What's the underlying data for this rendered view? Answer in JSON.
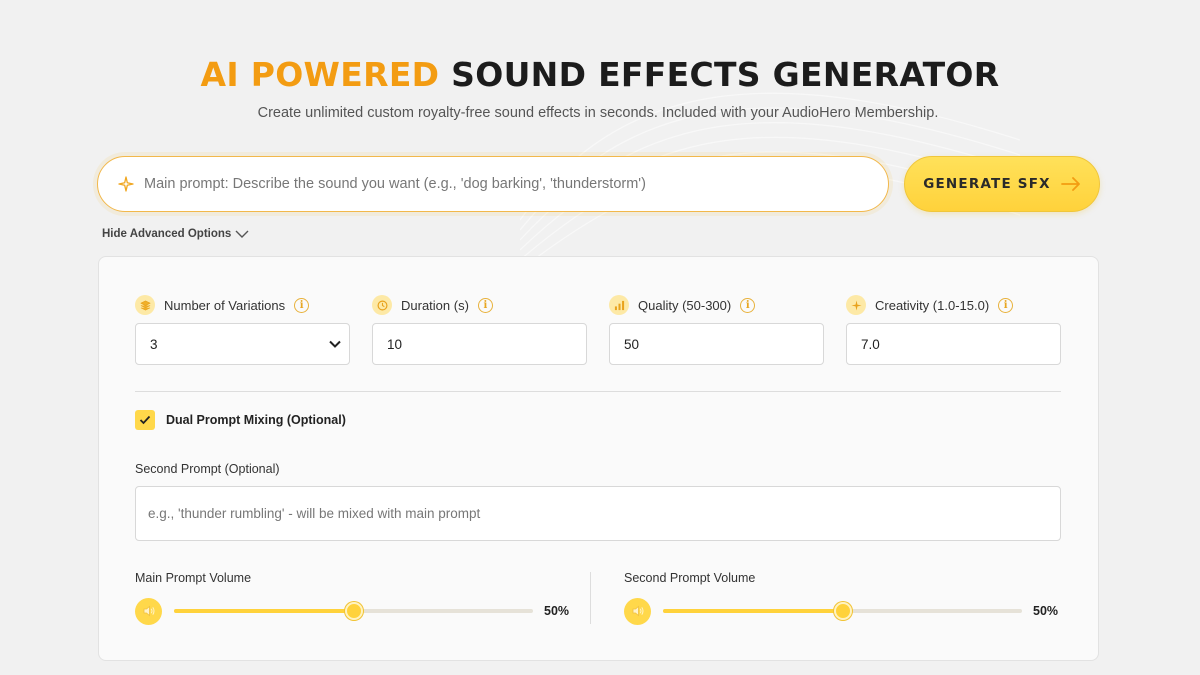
{
  "header": {
    "title_accent": "AI POWERED",
    "title_rest": "SOUND EFFECTS GENERATOR",
    "subtitle": "Create unlimited custom royalty-free sound effects in seconds. Included with your AudioHero Membership."
  },
  "main_prompt": {
    "placeholder": "Main prompt: Describe the sound you want (e.g., 'dog barking', 'thunderstorm')",
    "value": "",
    "icon": "sparkle-icon"
  },
  "generate_button": {
    "label": "GENERATE SFX",
    "icon": "arrow-right-icon"
  },
  "advanced_toggle": {
    "label": "Hide Advanced Options",
    "icon": "chevron-down-icon"
  },
  "fields": {
    "variations": {
      "label": "Number of Variations",
      "value": "3",
      "icon": "layers-icon",
      "options": [
        "3"
      ]
    },
    "duration": {
      "label": "Duration (s)",
      "value": "10",
      "icon": "clock-icon"
    },
    "quality": {
      "label": "Quality (50-300)",
      "value": "50",
      "icon": "bar-chart-icon"
    },
    "creativity": {
      "label": "Creativity (1.0-15.0)",
      "value": "7.0",
      "icon": "sparkle-icon"
    }
  },
  "dual_prompt": {
    "label": "Dual Prompt Mixing (Optional)",
    "checked": true,
    "second_prompt_label": "Second Prompt (Optional)",
    "second_prompt_placeholder": "e.g., 'thunder rumbling' - will be mixed with main prompt"
  },
  "volumes": {
    "main": {
      "label": "Main Prompt Volume",
      "value": 50,
      "display": "50%"
    },
    "second": {
      "label": "Second Prompt Volume",
      "value": 50,
      "display": "50%"
    }
  },
  "colors": {
    "accent": "#f39c12",
    "button": "#ffd23b",
    "icon_bg": "#fde9a6"
  }
}
